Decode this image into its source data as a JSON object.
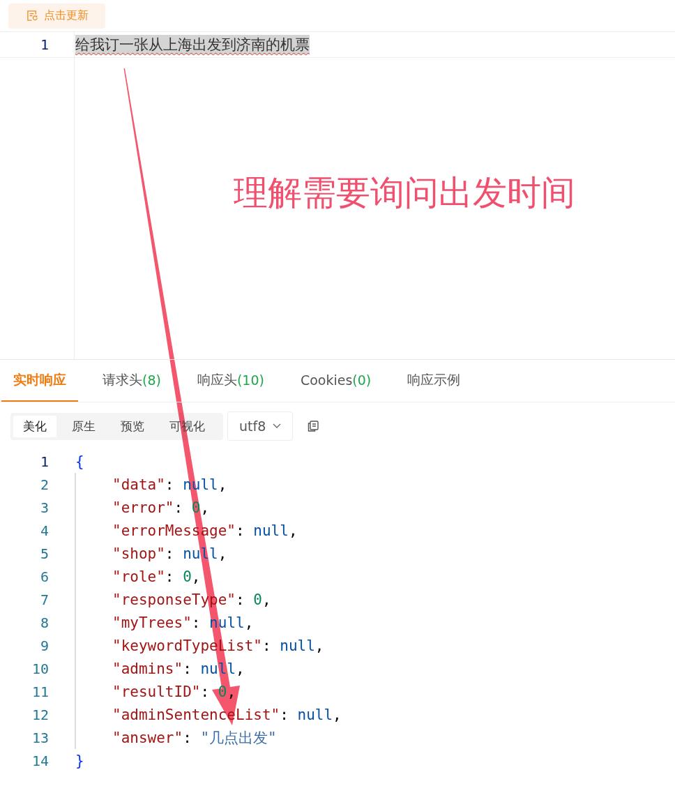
{
  "toolbar": {
    "update_button": "点击更新"
  },
  "request_editor": {
    "lines": [
      {
        "number": "1",
        "text": "给我订一张从上海出发到济南的机票",
        "highlighted": true,
        "spellcheck_error": true
      }
    ]
  },
  "annotation": {
    "text": "理解需要询问出发时间"
  },
  "response_tabs": [
    {
      "label": "实时响应",
      "selected": true
    },
    {
      "label": "请求头",
      "count": "(8)",
      "selected": false
    },
    {
      "label": "响应头",
      "count": "(10)",
      "selected": false
    },
    {
      "label": "Cookies",
      "count": "(0)",
      "selected": false
    },
    {
      "label": "响应示例",
      "selected": false
    }
  ],
  "view_modes": [
    {
      "label": "美化",
      "selected": true
    },
    {
      "label": "原生",
      "selected": false
    },
    {
      "label": "预览",
      "selected": false
    },
    {
      "label": "可视化",
      "selected": false
    }
  ],
  "encoding": "utf8",
  "response_body": {
    "lines": [
      {
        "number": "1",
        "indented": false,
        "tokens": [
          {
            "kind": "brace",
            "text": "{"
          }
        ]
      },
      {
        "number": "2",
        "indented": true,
        "tokens": [
          {
            "kind": "key",
            "text": "\"data\""
          },
          {
            "kind": "punct",
            "text": ": "
          },
          {
            "kind": "null",
            "text": "null"
          },
          {
            "kind": "punct",
            "text": ","
          }
        ]
      },
      {
        "number": "3",
        "indented": true,
        "tokens": [
          {
            "kind": "key",
            "text": "\"error\""
          },
          {
            "kind": "punct",
            "text": ": "
          },
          {
            "kind": "number",
            "text": "0"
          },
          {
            "kind": "punct",
            "text": ","
          }
        ]
      },
      {
        "number": "4",
        "indented": true,
        "tokens": [
          {
            "kind": "key",
            "text": "\"errorMessage\""
          },
          {
            "kind": "punct",
            "text": ": "
          },
          {
            "kind": "null",
            "text": "null"
          },
          {
            "kind": "punct",
            "text": ","
          }
        ]
      },
      {
        "number": "5",
        "indented": true,
        "tokens": [
          {
            "kind": "key",
            "text": "\"shop\""
          },
          {
            "kind": "punct",
            "text": ": "
          },
          {
            "kind": "null",
            "text": "null"
          },
          {
            "kind": "punct",
            "text": ","
          }
        ]
      },
      {
        "number": "6",
        "indented": true,
        "tokens": [
          {
            "kind": "key",
            "text": "\"role\""
          },
          {
            "kind": "punct",
            "text": ": "
          },
          {
            "kind": "number",
            "text": "0"
          },
          {
            "kind": "punct",
            "text": ","
          }
        ]
      },
      {
        "number": "7",
        "indented": true,
        "tokens": [
          {
            "kind": "key",
            "text": "\"responseType\""
          },
          {
            "kind": "punct",
            "text": ": "
          },
          {
            "kind": "number",
            "text": "0"
          },
          {
            "kind": "punct",
            "text": ","
          }
        ]
      },
      {
        "number": "8",
        "indented": true,
        "tokens": [
          {
            "kind": "key",
            "text": "\"myTrees\""
          },
          {
            "kind": "punct",
            "text": ": "
          },
          {
            "kind": "null",
            "text": "null"
          },
          {
            "kind": "punct",
            "text": ","
          }
        ]
      },
      {
        "number": "9",
        "indented": true,
        "tokens": [
          {
            "kind": "key",
            "text": "\"keywordTypeList\""
          },
          {
            "kind": "punct",
            "text": ": "
          },
          {
            "kind": "null",
            "text": "null"
          },
          {
            "kind": "punct",
            "text": ","
          }
        ]
      },
      {
        "number": "10",
        "indented": true,
        "tokens": [
          {
            "kind": "key",
            "text": "\"admins\""
          },
          {
            "kind": "punct",
            "text": ": "
          },
          {
            "kind": "null",
            "text": "null"
          },
          {
            "kind": "punct",
            "text": ","
          }
        ]
      },
      {
        "number": "11",
        "indented": true,
        "tokens": [
          {
            "kind": "key",
            "text": "\"resultID\""
          },
          {
            "kind": "punct",
            "text": ": "
          },
          {
            "kind": "number",
            "text": "0"
          },
          {
            "kind": "punct",
            "text": ","
          }
        ]
      },
      {
        "number": "12",
        "indented": true,
        "tokens": [
          {
            "kind": "key",
            "text": "\"adminSentenceList\""
          },
          {
            "kind": "punct",
            "text": ": "
          },
          {
            "kind": "null",
            "text": "null"
          },
          {
            "kind": "punct",
            "text": ","
          }
        ]
      },
      {
        "number": "13",
        "indented": true,
        "tokens": [
          {
            "kind": "key",
            "text": "\"answer\""
          },
          {
            "kind": "punct",
            "text": ": "
          },
          {
            "kind": "string",
            "text": "\"几点出发\""
          }
        ]
      },
      {
        "number": "14",
        "indented": false,
        "tokens": [
          {
            "kind": "brace",
            "text": "}"
          }
        ]
      }
    ]
  }
}
